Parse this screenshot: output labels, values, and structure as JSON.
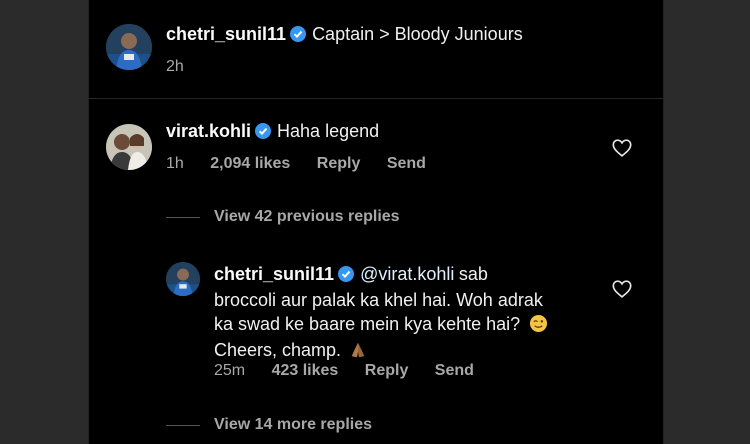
{
  "post": {
    "username": "chetri_sunil11",
    "caption": "Captain > Bloody Juniours",
    "time": "2h"
  },
  "comments": [
    {
      "username": "virat.kohli",
      "text": "Haha legend",
      "time": "1h",
      "likes": "2,094 likes",
      "reply": "Reply",
      "send": "Send"
    }
  ],
  "view_previous": "View 42 previous replies",
  "reply": {
    "username": "chetri_sunil11",
    "mention": "@virat.kohli",
    "line1_rest": "sab",
    "line2": "broccoli aur palak ka khel hai. Woh adrak",
    "line3": "ka swad ke baare mein kya kehte hai?",
    "line4": "Cheers, champ.",
    "time": "25m",
    "likes": "423 likes",
    "reply": "Reply",
    "send": "Send"
  },
  "view_more": "View 14 more replies",
  "icons": {
    "verified": "verified-badge-icon",
    "heart": "heart-outline-icon",
    "wink": "winking-face-emoji",
    "pray": "folded-hands-emoji"
  },
  "colors": {
    "background": "#000000",
    "verified": "#3897f0",
    "muted": "#a8a8a8"
  }
}
